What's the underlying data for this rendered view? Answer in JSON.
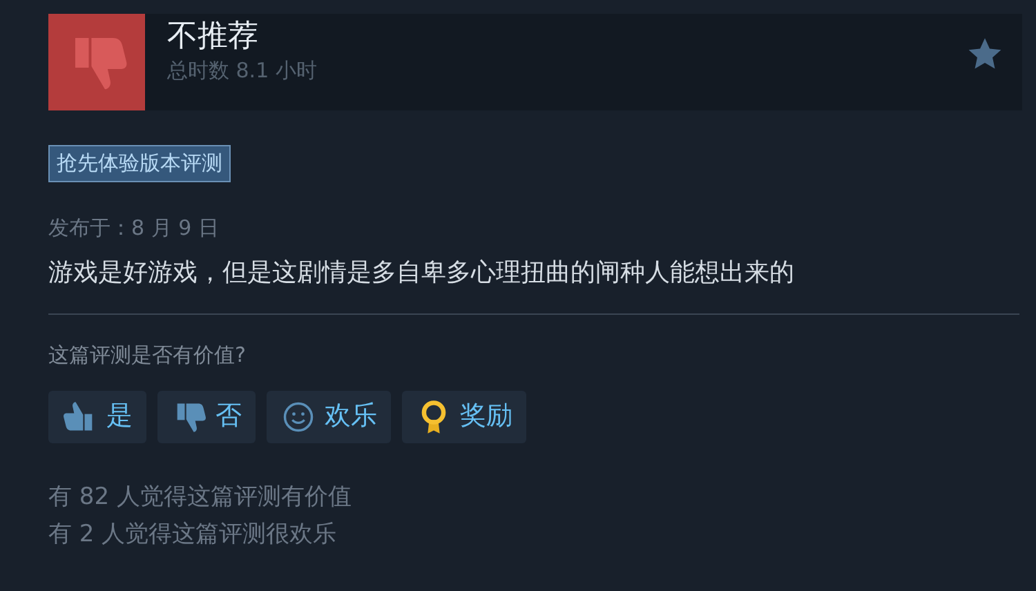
{
  "review": {
    "recommended": false,
    "verdict": "不推荐",
    "playtime": "总时数 8.1 小时",
    "badge": "抢先体验版本评测",
    "posted": "发布于：8 月 9 日",
    "text": "游戏是好游戏，但是这剧情是多自卑多心理扭曲的闸种人能想出来的"
  },
  "feedback": {
    "question": "这篇评测是否有价值?",
    "buttons": [
      {
        "kind": "thumbs-up",
        "label": "是"
      },
      {
        "kind": "thumbs-down",
        "label": "否"
      },
      {
        "kind": "smile",
        "label": "欢乐"
      },
      {
        "kind": "award",
        "label": "奖励"
      }
    ]
  },
  "stats": [
    "有 82 人觉得这篇评测有价值",
    "有 2 人觉得这篇评测很欢乐"
  ]
}
